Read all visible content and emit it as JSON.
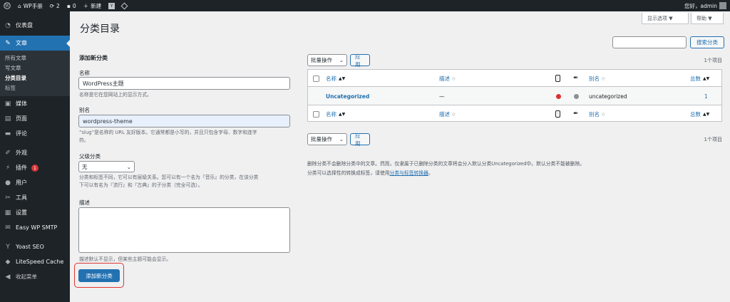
{
  "adminbar": {
    "site_name": "WP手册",
    "updates_count": "2",
    "comments_count": "0",
    "new_label": "新建",
    "greeting": "您好，admin"
  },
  "sidebar": {
    "items": [
      {
        "label": "仪表盘",
        "icon": "dashboard-icon"
      },
      {
        "label": "文章",
        "icon": "pin-icon",
        "current": true
      },
      {
        "label": "媒体",
        "icon": "media-icon"
      },
      {
        "label": "页面",
        "icon": "page-icon"
      },
      {
        "label": "评论",
        "icon": "comment-icon"
      },
      {
        "label": "外观",
        "icon": "brush-icon"
      },
      {
        "label": "插件",
        "icon": "plugin-icon",
        "badge": "1"
      },
      {
        "label": "用户",
        "icon": "user-icon"
      },
      {
        "label": "工具",
        "icon": "wrench-icon"
      },
      {
        "label": "设置",
        "icon": "settings-icon"
      },
      {
        "label": "Easy WP SMTP",
        "icon": "smtp-icon"
      },
      {
        "label": "Yoast SEO",
        "icon": "yoast-icon"
      },
      {
        "label": "LiteSpeed Cache",
        "icon": "litespeed-icon"
      },
      {
        "label": "收起菜单",
        "icon": "collapse-icon"
      }
    ],
    "submenu": [
      "所有文章",
      "写文章",
      "分类目录",
      "标签"
    ]
  },
  "page": {
    "title": "分类目录",
    "screen_options": "显示选项 ▼",
    "help": "帮助 ▼",
    "search_button": "搜索分类"
  },
  "form": {
    "heading": "添加新分类",
    "name_label": "名称",
    "name_value": "WordPress主题",
    "name_help": "名称是它在您网站上的显示方式。",
    "slug_label": "别名",
    "slug_value": "wordpress-theme",
    "slug_help_1": "“slug”是名称的 URL 友好版本。它通常都是小写的，并且只包含字母、数字和连字",
    "slug_help_2": "符。",
    "parent_label": "父级分类",
    "parent_value": "无",
    "parent_help_1": "分类和标签不同，它可以有层级关系。您可以有一个名为『音乐』的分类，在该分类",
    "parent_help_2": "下可以有名为『流行』和『古典』的子分类（完全可选）。",
    "desc_label": "描述",
    "desc_help": "描述默认不显示，但某些主题可能会显示。",
    "submit": "添加新分类"
  },
  "table": {
    "bulk_label": "批量操作",
    "apply": "应用",
    "items_count": "1个项目",
    "columns": {
      "name": "名称",
      "desc": "描述",
      "slug": "别名",
      "count": "总数"
    },
    "rows": [
      {
        "name": "Uncategorized",
        "desc": "—",
        "slug": "uncategorized",
        "count": "1"
      }
    ],
    "status_colors": {
      "seo": "#dc3232",
      "readability": "#8c8f94"
    }
  },
  "notes": {
    "line1": "删除分类不会删除分类中的文章。然而，仅隶属于已删除分类的文章将会分入默认分类Uncategorized中。默认分类不能被删除。",
    "line2_prefix": "分类可以选择性的转换成标签，请使用",
    "line2_link": "分类与标签转换器",
    "line2_suffix": "。"
  }
}
